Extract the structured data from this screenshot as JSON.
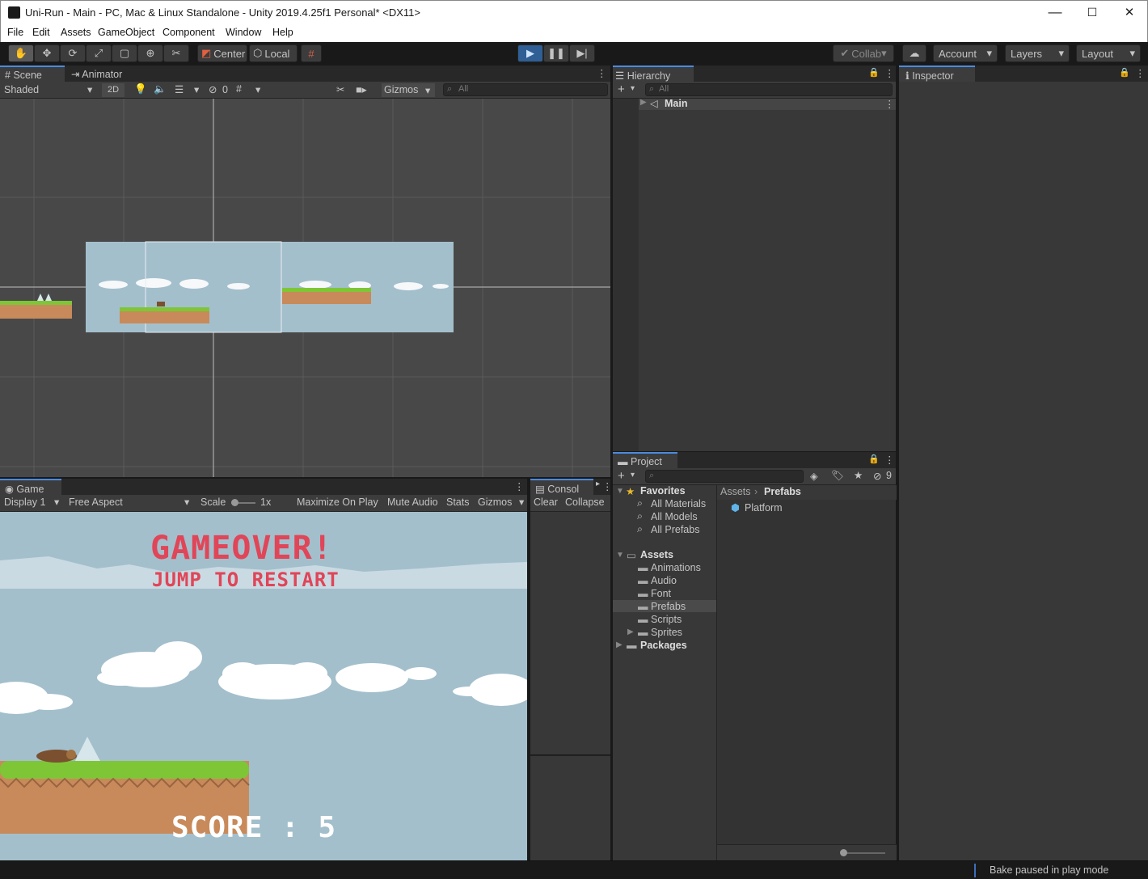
{
  "window": {
    "title": "Uni-Run - Main - PC, Mac & Linux Standalone - Unity 2019.4.25f1 Personal* <DX11>",
    "minimize": "—",
    "maximize": "☐",
    "close": "✕"
  },
  "menu": [
    "File",
    "Edit",
    "Assets",
    "GameObject",
    "Component",
    "Window",
    "Help"
  ],
  "toolbar": {
    "pivot": "Center",
    "space": "Local",
    "collab": "Collab",
    "account": "Account",
    "layers": "Layers",
    "layout": "Layout"
  },
  "scene": {
    "tab_scene": "Scene",
    "tab_animator": "Animator",
    "shading": "Shaded",
    "mode_2d": "2D",
    "hidden_count": "0",
    "gizmos": "Gizmos",
    "search_placeholder": "All"
  },
  "hierarchy": {
    "title": "Hierarchy",
    "search_placeholder": "All",
    "root": "Main"
  },
  "inspector": {
    "title": "Inspector"
  },
  "game": {
    "tab": "Game",
    "display": "Display 1",
    "aspect": "Free Aspect",
    "scale_label": "Scale",
    "scale_value": "1x",
    "maximize": "Maximize On Play",
    "mute": "Mute Audio",
    "stats": "Stats",
    "gizmos": "Gizmos",
    "gameover": "GAMEOVER!",
    "restart": "JUMP TO RESTART",
    "score": "SCORE : 5"
  },
  "console": {
    "tab": "Consol",
    "clear": "Clear",
    "collapse": "Collapse"
  },
  "project": {
    "title": "Project",
    "hidden_count": "9",
    "favorites": "Favorites",
    "fav_items": [
      "All Materials",
      "All Models",
      "All Prefabs"
    ],
    "assets": "Assets",
    "asset_folders": [
      "Animations",
      "Audio",
      "Font",
      "Prefabs",
      "Scripts",
      "Sprites"
    ],
    "packages": "Packages",
    "breadcrumb_root": "Assets",
    "breadcrumb_current": "Prefabs",
    "items": [
      "Platform"
    ]
  },
  "status": {
    "message": "Bake paused in play mode"
  },
  "colors": {
    "accent": "#4a8be0",
    "sky": "#a3bfcc",
    "grass": "#7ec636",
    "dirt": "#c88a5a",
    "title_red": "#e04558"
  }
}
